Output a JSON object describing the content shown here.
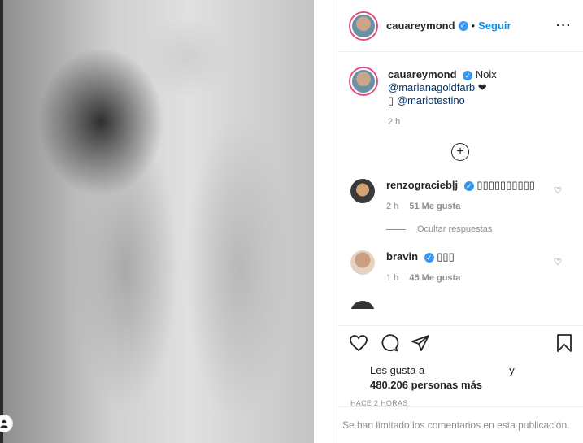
{
  "post": {
    "photo_alt": "",
    "author": "cauareymond",
    "separator": "•",
    "follow_label": "Seguir",
    "more_label": "···"
  },
  "caption": {
    "username": "cauareymond",
    "text": "Noix",
    "mention1": "@marianagoldfarb",
    "heart": "❤",
    "camera": "▯",
    "mention2": "@mariotestino",
    "time": "2 h"
  },
  "comments": [
    {
      "username": "renzogracieb|j",
      "text": "▯▯▯▯▯▯▯▯▯▯",
      "time": "2 h",
      "likes": "51 Me gusta"
    },
    {
      "username": "bravin",
      "text": "▯▯▯",
      "time": "1 h",
      "likes": "45 Me gusta"
    }
  ],
  "hide_replies_label": "Ocultar respuestas",
  "likes": {
    "prefix": "Les gusta a",
    "y": "y",
    "count": "480.206 personas más"
  },
  "timestamp": "HACE 2 HORAS",
  "footer_text": "Se han limitado los comentarios en esta publicación."
}
